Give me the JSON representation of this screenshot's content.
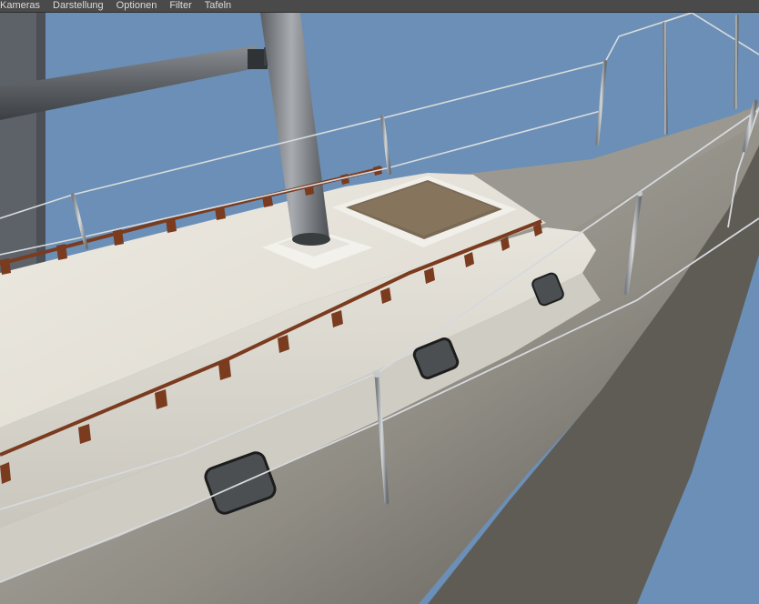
{
  "menu": {
    "items": [
      {
        "label": "Kameras"
      },
      {
        "label": "Darstellung"
      },
      {
        "label": "Optionen"
      },
      {
        "label": "Filter"
      },
      {
        "label": "Tafeln"
      }
    ]
  },
  "viewport": {
    "scene": "sailboat-deck-render",
    "background_color": "#6b8fb6"
  }
}
